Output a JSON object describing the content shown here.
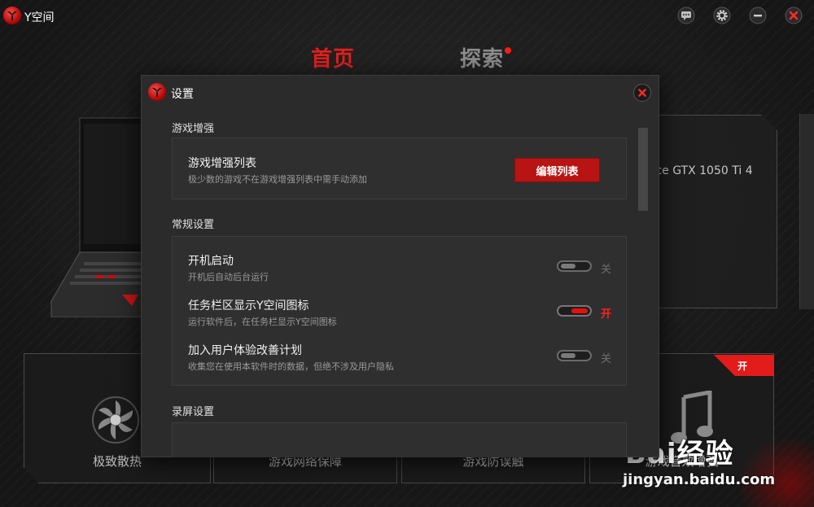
{
  "app": {
    "title": "Y空间",
    "window_buttons": [
      "feedback-icon",
      "gear-icon",
      "minimize-icon",
      "close-icon"
    ]
  },
  "main_tabs": [
    {
      "label": "首页",
      "active": true
    },
    {
      "label": "探索",
      "active": false,
      "has_notification_dot": true
    }
  ],
  "background": {
    "gpu_text": "rce GTX 1050 Ti 4",
    "feature_cards": [
      {
        "label": "极致散热"
      },
      {
        "label": "游戏网络保障"
      },
      {
        "label": "游戏防误触"
      },
      {
        "label": "游戏音效增强",
        "badge": "开"
      }
    ],
    "watermark": {
      "brand": "Bai经验",
      "url": "jingyan.baidu.com"
    }
  },
  "settings_dialog": {
    "title": "设置",
    "sections": [
      {
        "title": "游戏增强",
        "items": [
          {
            "title": "游戏增强列表",
            "description": "极少数的游戏不在游戏增强列表中需手动添加",
            "button": "编辑列表"
          }
        ]
      },
      {
        "title": "常规设置",
        "items": [
          {
            "title": "开机启动",
            "description": "开机后自动后台运行",
            "toggle": false,
            "state_label": "关"
          },
          {
            "title": "任务栏区显示Y空间图标",
            "description": "运行软件后，在任务栏显示Y空间图标",
            "toggle": true,
            "state_label": "开"
          },
          {
            "title": "加入用户体验改善计划",
            "description": "收集您在使用本软件时的数据，但绝不涉及用户隐私",
            "toggle": false,
            "state_label": "关"
          }
        ]
      },
      {
        "title": "录屏设置",
        "items": []
      }
    ]
  },
  "colors": {
    "accent_red": "#e52020",
    "button_red": "#b81414",
    "dialog_bg": "#2b2b2b",
    "app_bg": "#1c1c1c"
  }
}
